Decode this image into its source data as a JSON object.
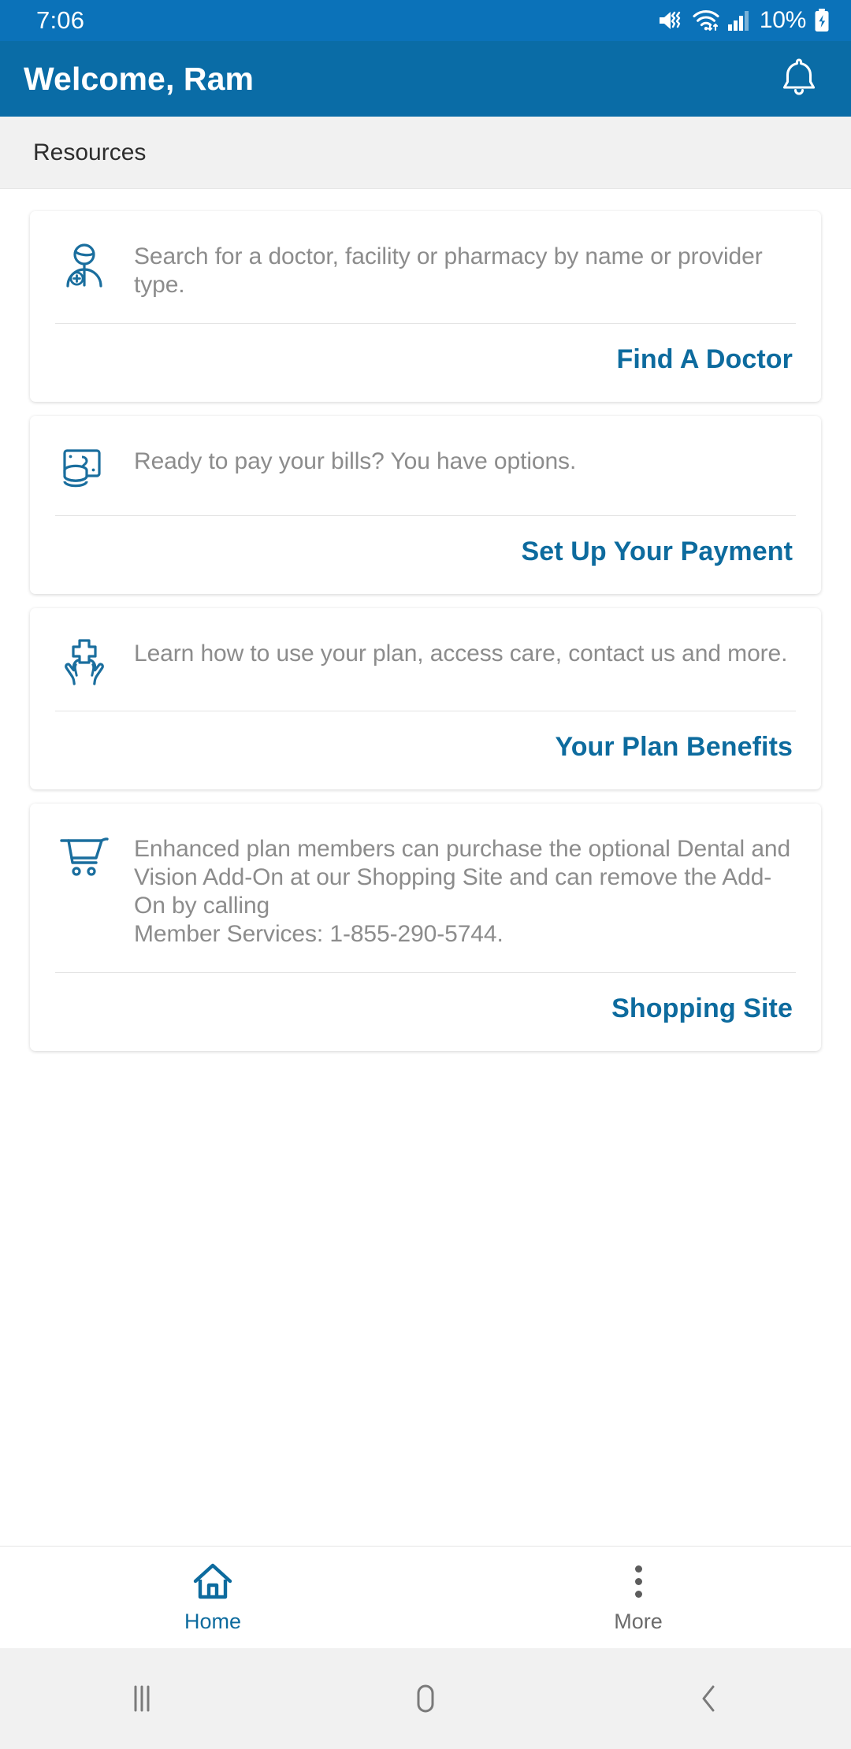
{
  "status_bar": {
    "time": "7:06",
    "battery_percent": "10%",
    "icons": [
      "mute-vibrate-icon",
      "wifi-icon",
      "cellular-signal-icon",
      "battery-charging-icon"
    ]
  },
  "app_bar": {
    "title": "Welcome, Ram",
    "notification_icon": "bell-icon"
  },
  "section": {
    "title": "Resources"
  },
  "colors": {
    "status_bar": "#0b72b9",
    "app_bar": "#0a6ca6",
    "accent_link": "#0d6b9e",
    "icon_blue": "#1a6e9e",
    "body_text": "#8c8c8c",
    "section_bg": "#f1f1f1"
  },
  "cards": [
    {
      "icon": "doctor-icon",
      "text": "Search for a doctor, facility or pharmacy by name or provider type.",
      "action_label": "Find A Doctor"
    },
    {
      "icon": "money-bill-icon",
      "text": "Ready to pay your bills? You have options.",
      "action_label": "Set Up Your Payment"
    },
    {
      "icon": "hands-cross-icon",
      "text": "Learn how to use your plan, access care, contact us and more.",
      "action_label": "Your Plan Benefits"
    },
    {
      "icon": "shopping-cart-icon",
      "text": "Enhanced plan members can purchase the optional Dental and Vision Add-On at our Shopping Site and can remove the Add-On by calling\nMember Services:  1-855-290-5744.",
      "action_label": "Shopping Site"
    }
  ],
  "bottom_nav": {
    "items": [
      {
        "label": "Home",
        "icon": "home-icon",
        "active": true
      },
      {
        "label": "More",
        "icon": "three-dots-icon",
        "active": false
      }
    ]
  },
  "system_nav": {
    "recents_icon": "recents-icon",
    "home_icon": "home-square-icon",
    "back_icon": "back-chevron-icon"
  }
}
